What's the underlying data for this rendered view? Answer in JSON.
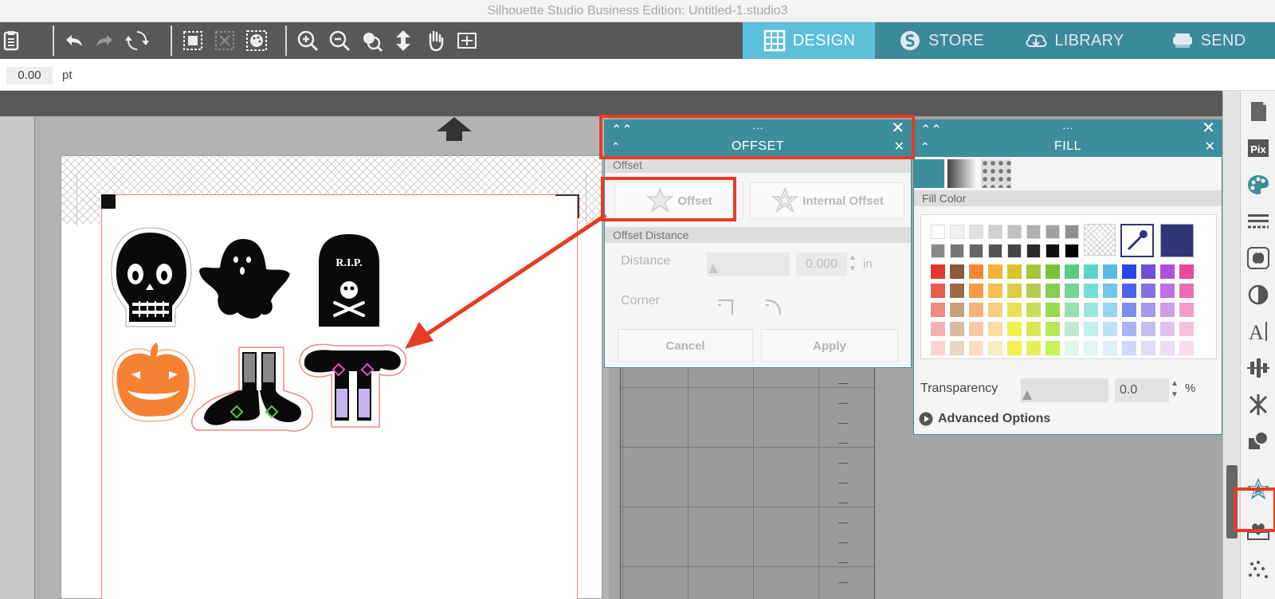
{
  "window": {
    "title": "Silhouette Studio Business Edition: Untitled-1.studio3"
  },
  "nav_tabs": [
    {
      "label": "DESIGN",
      "active": true
    },
    {
      "label": "STORE",
      "active": false
    },
    {
      "label": "LIBRARY",
      "active": false
    },
    {
      "label": "SEND",
      "active": false
    }
  ],
  "options_bar": {
    "value": "0.00",
    "unit": "pt"
  },
  "offset_panel": {
    "dots": "···",
    "title": "OFFSET",
    "section_offset": "Offset",
    "offset_button": "Offset",
    "internal_offset_button": "Internal Offset",
    "section_distance": "Offset Distance",
    "distance_label": "Distance",
    "distance_value": "0.000",
    "distance_unit": "in",
    "corner_label": "Corner",
    "cancel_button": "Cancel",
    "apply_button": "Apply"
  },
  "fill_panel": {
    "dots": "···",
    "title": "FILL",
    "section_fill_color": "Fill Color",
    "transparency_label": "Transparency",
    "transparency_value": "0.0",
    "transparency_unit": "%",
    "advanced_options": "Advanced Options",
    "selected_color": "#2f3577",
    "palette_rows": [
      [
        "#ffffff",
        "#f0f0f0",
        "#e0e0e0",
        "#d0d0d0",
        "#c0c0c0",
        "#b0b0b0",
        "#a0a0a0",
        "#909090"
      ],
      [
        "#888888",
        "#777777",
        "#666666",
        "#555555",
        "#444444",
        "#2a2a2a",
        "#111111",
        "#000000"
      ],
      [
        "#e23b2e",
        "#8a5a3a",
        "#ef8a32",
        "#f2b233",
        "#d8c42c",
        "#a9c43a",
        "#78c23a",
        "#5acb7f",
        "#5cd6c9",
        "#5ab8e5",
        "#2a45e6",
        "#6d4fd6",
        "#b04fdc",
        "#e54aa0"
      ],
      [
        "#ec5b4f",
        "#9c6b4a",
        "#f29a4a",
        "#f4bf4f",
        "#ddcc45",
        "#b5cc53",
        "#89cc53",
        "#74d494",
        "#75ddd3",
        "#73c6ea",
        "#4a63ea",
        "#8670df",
        "#bf70e3",
        "#ea6fb2"
      ],
      [
        "#f08a82",
        "#c7a07f",
        "#f5b47c",
        "#f7cf7c",
        "#e8e153",
        "#c8db5b",
        "#9ad94e",
        "#98e0b1",
        "#9ce6df",
        "#98d5f0",
        "#7b8ef0",
        "#a598e7",
        "#d09de9",
        "#f09ec9"
      ],
      [
        "#f5b1ab",
        "#d8bc9f",
        "#f8c9a1",
        "#f9dd9f",
        "#f1ef4b",
        "#d9e655",
        "#b6e858",
        "#c0ead0",
        "#c2efea",
        "#bce3f5",
        "#a7b4f5",
        "#c5bdee",
        "#e0c1f0",
        "#f5c1dd"
      ],
      [
        "#f9d4d0",
        "#e7d6c4",
        "#fbddc4",
        "#fbebc4",
        "#f5f04a",
        "#e6ee5a",
        "#c8f058",
        "#e1f5e8",
        "#e0f7f4",
        "#dcf0fa",
        "#d0d7fa",
        "#e0dbf6",
        "#eddcf7",
        "#fadced"
      ]
    ]
  },
  "colors": {
    "accent_teal": "#3d8d9c",
    "design_tab": "#5dc0da",
    "highlight_red": "#e63c23",
    "pumpkin": "#f58234"
  },
  "icons": {
    "toolbar": [
      "clipboard-icon",
      "undo-icon",
      "redo-icon",
      "refresh-icon",
      "group-icon",
      "ungroup-icon",
      "palette-select-icon",
      "zoom-in-icon",
      "zoom-out-icon",
      "zoom-select-icon",
      "move-page-icon",
      "pan-hand-icon",
      "fit-to-page-icon"
    ],
    "rail": [
      "page-setup-icon",
      "pixscan-icon",
      "fill-icon",
      "line-style-icon",
      "image-effects-icon",
      "contrast-icon",
      "text-icon",
      "align-icon",
      "replicate-icon",
      "modify-icon",
      "offset-star-icon",
      "trace-icon",
      "sketch-icon"
    ]
  }
}
